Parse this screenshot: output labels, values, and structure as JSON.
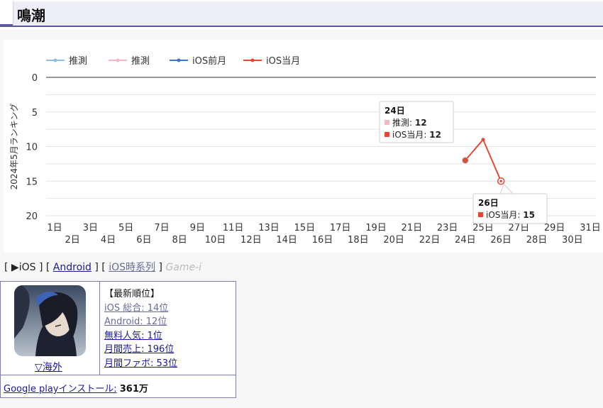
{
  "header": {
    "title": "鳴潮"
  },
  "chart_data": {
    "type": "line",
    "ylabel": "2024年5月ランキング",
    "ylim": [
      0,
      20
    ],
    "y_inverted": true,
    "yticks": [
      0,
      5,
      10,
      15,
      20
    ],
    "x_tick_labels": [
      "1日",
      "2日",
      "3日",
      "4日",
      "5日",
      "6日",
      "7日",
      "8日",
      "9日",
      "10日",
      "11日",
      "12日",
      "13日",
      "14日",
      "15日",
      "16日",
      "17日",
      "18日",
      "19日",
      "20日",
      "21日",
      "22日",
      "23日",
      "24日",
      "25日",
      "26日",
      "27日",
      "28日",
      "29日",
      "30日",
      "31日"
    ],
    "legend_position": "top-left",
    "series": [
      {
        "name": "推測",
        "color": "#8fbde3",
        "x": [],
        "y": []
      },
      {
        "name": "推測",
        "color": "#f2b8c6",
        "x": [
          24
        ],
        "y": [
          12
        ]
      },
      {
        "name": "iOS前月",
        "color": "#3f74c7",
        "x": [],
        "y": []
      },
      {
        "name": "iOS当月",
        "color": "#e34a33",
        "x": [
          24,
          25,
          26
        ],
        "y": [
          12,
          9,
          15
        ]
      }
    ],
    "tooltips": [
      {
        "title": "24日",
        "rows": [
          {
            "label": "推測",
            "value": "12",
            "color": "#f2b8c6"
          },
          {
            "label": "iOS当月",
            "value": "12",
            "color": "#e34a33"
          }
        ]
      },
      {
        "title": "26日",
        "rows": [
          {
            "label": "iOS当月",
            "value": "15",
            "color": "#e34a33"
          }
        ]
      }
    ]
  },
  "tabs": {
    "open": "[",
    "ios": "▶iOS",
    "sep1": "]",
    "open2": "[",
    "android": "Android",
    "sep2": "]",
    "open3": "[",
    "ios_timeseries": "iOS時系列",
    "sep3": "]",
    "game_i": "Game-i"
  },
  "info": {
    "region_link": "▽海外",
    "latest_rank_head": "【最新順位】",
    "ranks": [
      "iOS 総合: 14位",
      "Android: 12位",
      "無料人気: 1位",
      "月間売上: 196位",
      "月間ファボ: 53位"
    ],
    "install_link": "Google playインストール:",
    "install_value": "361万"
  }
}
